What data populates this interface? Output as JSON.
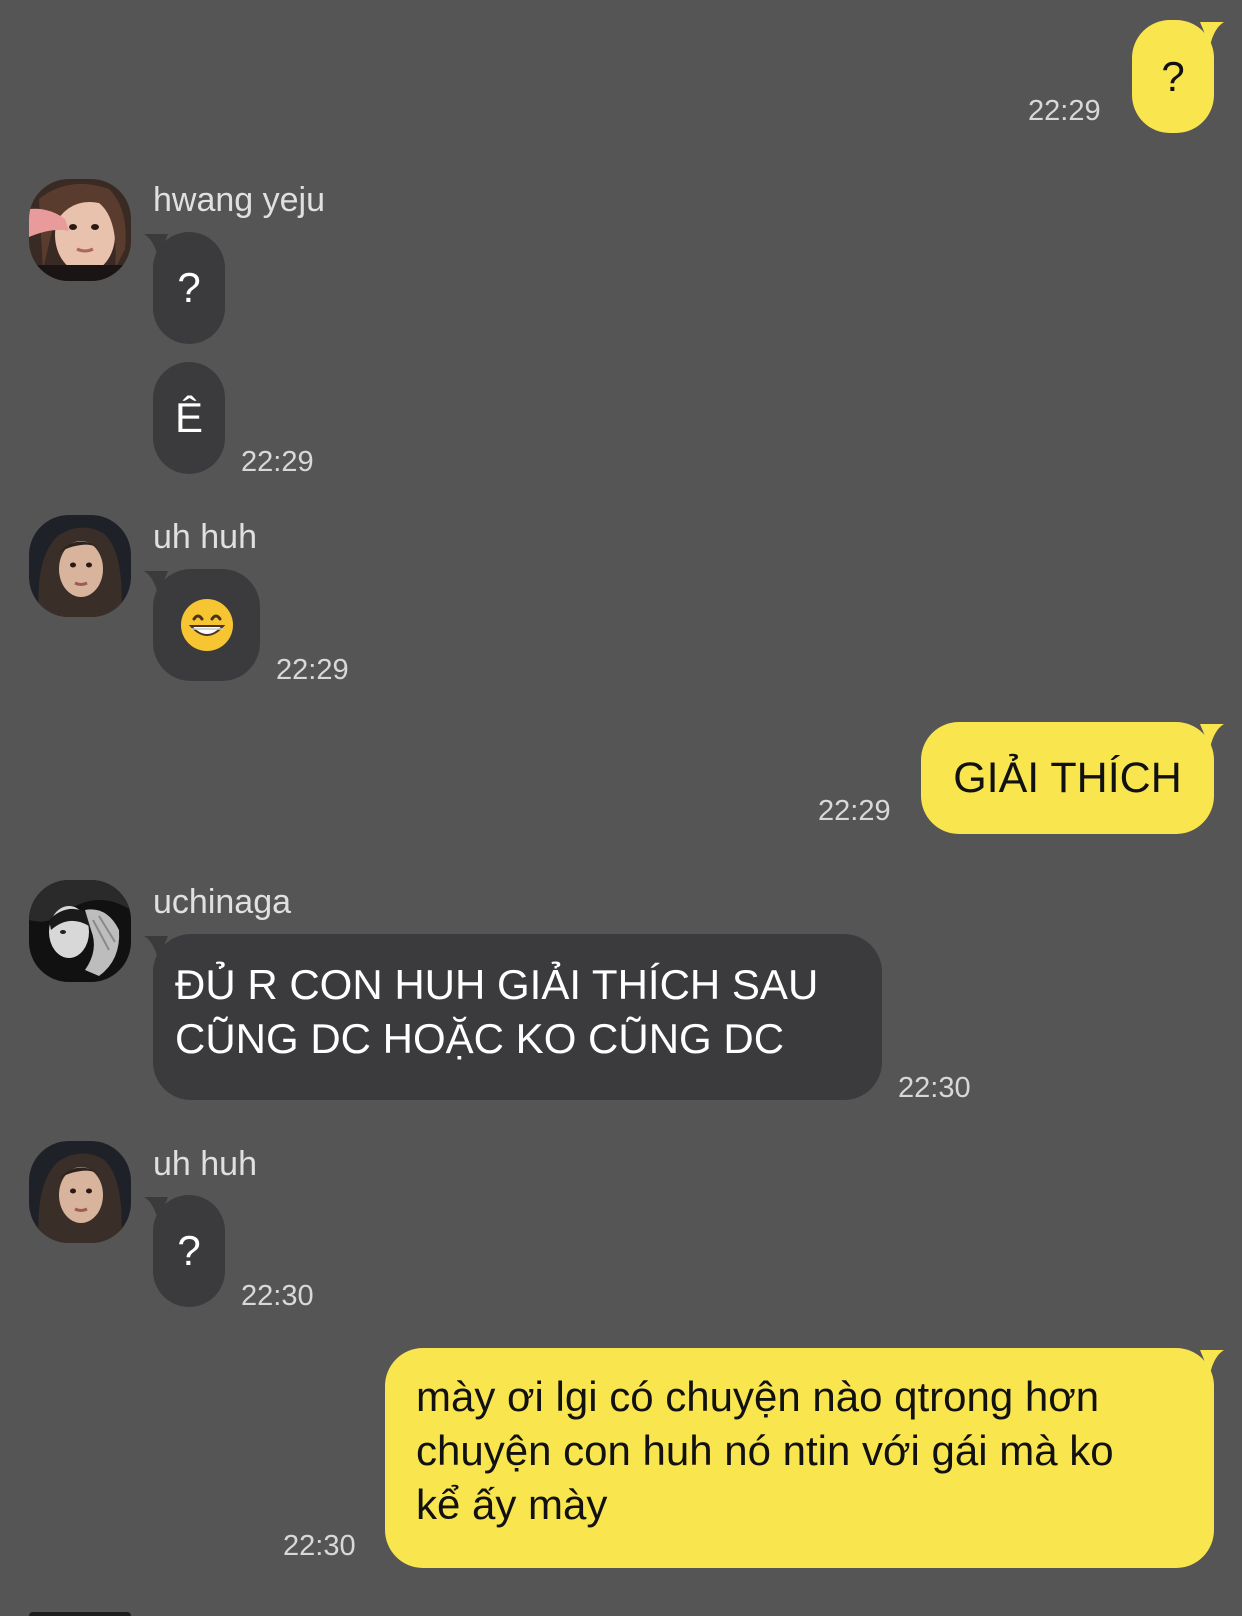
{
  "colors": {
    "background": "#555555",
    "incoming_bubble": "#3b3b3d",
    "outgoing_bubble": "#f9e54e",
    "timestamp": "#d8d8d8"
  },
  "messages": [
    {
      "direction": "outgoing",
      "text": "?",
      "time": "22:29"
    },
    {
      "direction": "incoming",
      "sender": "hwang yeju",
      "avatar": "avatar-hwang-yeju",
      "text": "?"
    },
    {
      "direction": "incoming",
      "text": "Ê",
      "time": "22:29"
    },
    {
      "direction": "incoming",
      "sender": "uh huh",
      "avatar": "avatar-uh-huh",
      "text": "😁",
      "icon": "grinning-face-emoji",
      "time": "22:29"
    },
    {
      "direction": "outgoing",
      "text": "GIẢI THÍCH",
      "time": "22:29"
    },
    {
      "direction": "incoming",
      "sender": "uchinaga",
      "avatar": "avatar-uchinaga",
      "lines": [
        "ĐỦ R CON HUH GIẢI THÍCH SAU",
        "CŨNG DC HOẶC KO CŨNG DC"
      ],
      "time": "22:30"
    },
    {
      "direction": "incoming",
      "sender": "uh huh",
      "avatar": "avatar-uh-huh",
      "text": "?",
      "time": "22:30"
    },
    {
      "direction": "outgoing",
      "lines": [
        "mày ơi lgi có chuyện nào qtrong hơn",
        "chuyện con huh nó ntin với gái mà ko",
        "kể ấy mày"
      ],
      "time": "22:30"
    }
  ]
}
